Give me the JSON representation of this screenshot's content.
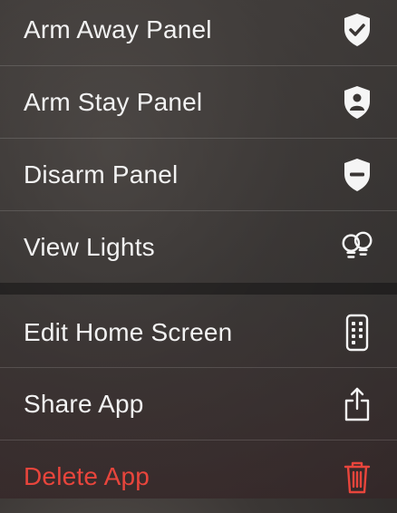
{
  "menu": {
    "items": [
      {
        "label": "Arm Away Panel",
        "icon": "shield-check-icon"
      },
      {
        "label": "Arm Stay Panel",
        "icon": "shield-person-icon"
      },
      {
        "label": "Disarm Panel",
        "icon": "shield-minus-icon"
      },
      {
        "label": "View Lights",
        "icon": "lightbulbs-icon"
      }
    ],
    "system_items": [
      {
        "label": "Edit Home Screen",
        "icon": "phone-apps-icon"
      },
      {
        "label": "Share App",
        "icon": "share-icon"
      },
      {
        "label": "Delete App",
        "icon": "trash-icon",
        "destructive": true
      }
    ]
  },
  "colors": {
    "text": "#f2f2f2",
    "destructive": "#e8453c"
  }
}
